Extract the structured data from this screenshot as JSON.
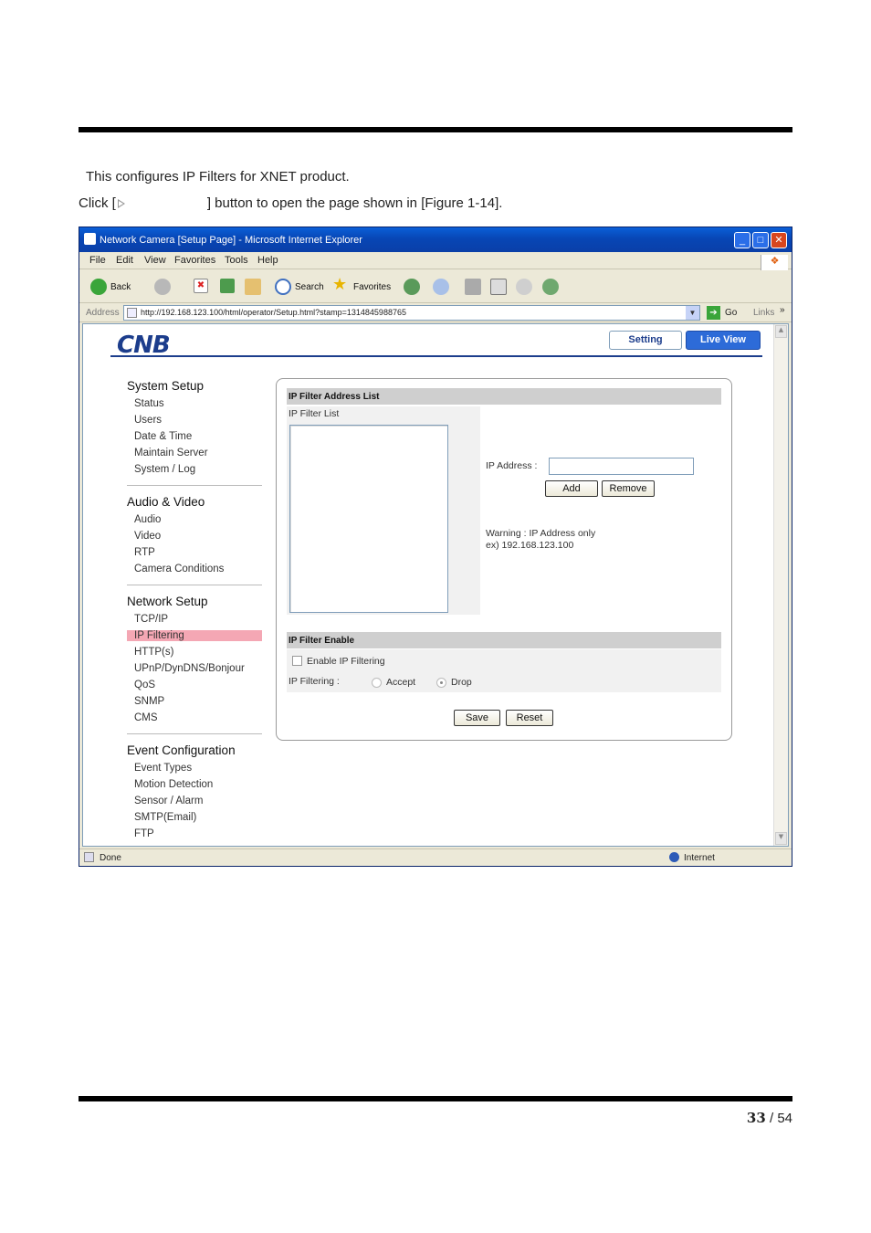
{
  "intro": {
    "line1": "This configures IP Filters for XNET product.",
    "click_pre": "Click [",
    "click_post": "] button to open the page shown in [Figure 1-14]."
  },
  "browser": {
    "title": "Network Camera [Setup Page] - Microsoft Internet Explorer",
    "menu": [
      "File",
      "Edit",
      "View",
      "Favorites",
      "Tools",
      "Help"
    ],
    "toolbar": {
      "back": "Back",
      "search": "Search",
      "favorites": "Favorites"
    },
    "address_label": "Address",
    "url": "http://192.168.123.100/html/operator/Setup.html?stamp=1314845988765",
    "go": "Go",
    "links": "Links",
    "status_left": "Done",
    "status_zone": "Internet"
  },
  "page": {
    "logo": "CNB",
    "tab_setting": "Setting",
    "tab_live": "Live View",
    "menu": {
      "system": {
        "title": "System Setup",
        "items": [
          "Status",
          "Users",
          "Date & Time",
          "Maintain Server",
          "System / Log"
        ]
      },
      "av": {
        "title": "Audio & Video",
        "items": [
          "Audio",
          "Video",
          "RTP",
          "Camera Conditions"
        ]
      },
      "network": {
        "title": "Network Setup",
        "items": [
          "TCP/IP",
          "IP Filtering",
          "HTTP(s)",
          "UPnP/DynDNS/Bonjour",
          "QoS",
          "SNMP",
          "CMS"
        ]
      },
      "event": {
        "title": "Event Configuration",
        "items": [
          "Event Types",
          "Motion Detection",
          "Sensor / Alarm",
          "SMTP(Email)",
          "FTP"
        ]
      }
    },
    "panel": {
      "list_header": "IP Filter Address List",
      "list_label": "IP Filter List",
      "ip_label": "IP Address :",
      "add": "Add",
      "remove": "Remove",
      "warning1": "Warning : IP Address only",
      "warning2": "ex) 192.168.123.100",
      "enable_header": "IP Filter Enable",
      "enable_label": "Enable IP Filtering",
      "filter_label": "IP Filtering :",
      "accept": "Accept",
      "drop": "Drop",
      "selected_mode": "Drop",
      "save": "Save",
      "reset": "Reset"
    }
  },
  "footer": {
    "current": "33",
    "sep": "/",
    "total": "54"
  }
}
